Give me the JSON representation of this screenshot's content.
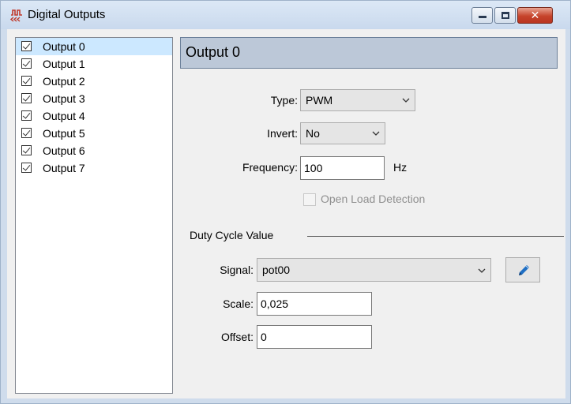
{
  "window": {
    "title": "Digital Outputs",
    "app_icon": "signal-waveform-icon",
    "controls": {
      "minimize_icon": "minimize-icon",
      "maximize_icon": "maximize-icon",
      "close_icon": "close-icon",
      "close_glyph": "✕"
    }
  },
  "outputs_list": {
    "items": [
      {
        "label": "Output 0",
        "checked": true,
        "selected": true
      },
      {
        "label": "Output 1",
        "checked": true
      },
      {
        "label": "Output 2",
        "checked": true
      },
      {
        "label": "Output 3",
        "checked": true
      },
      {
        "label": "Output 4",
        "checked": true
      },
      {
        "label": "Output 5",
        "checked": true
      },
      {
        "label": "Output 6",
        "checked": true
      },
      {
        "label": "Output 7",
        "checked": true
      }
    ]
  },
  "detail": {
    "header_title": "Output 0",
    "type": {
      "label": "Type:",
      "value": "PWM"
    },
    "invert": {
      "label": "Invert:",
      "value": "No"
    },
    "frequency": {
      "label": "Frequency:",
      "value": "100",
      "unit": "Hz"
    },
    "open_load_detection": {
      "label": "Open Load Detection",
      "checked": false,
      "enabled": false
    }
  },
  "duty_cycle": {
    "group_title": "Duty Cycle Value",
    "signal": {
      "label": "Signal:",
      "value": "pot00",
      "edit_icon": "pencil-icon"
    },
    "scale": {
      "label": "Scale:",
      "value": "0,025"
    },
    "offset": {
      "label": "Offset:",
      "value": "0"
    }
  },
  "colors": {
    "selection": "#cce8ff",
    "header_bg": "#bcc8d8",
    "pencil": "#1f6fc4",
    "close_button": "#c6432b"
  }
}
